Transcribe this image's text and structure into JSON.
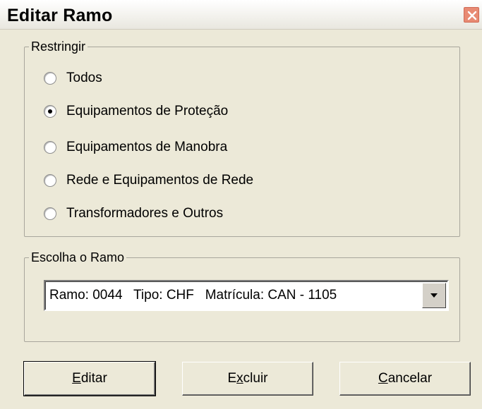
{
  "window": {
    "title": "Editar Ramo"
  },
  "restrict": {
    "legend": "Restringir",
    "options": [
      {
        "label": "Todos",
        "checked": false
      },
      {
        "label": "Equipamentos de Proteção",
        "checked": true
      },
      {
        "label": "Equipamentos de Manobra",
        "checked": false
      },
      {
        "label": "Rede e Equipamentos de Rede",
        "checked": false
      },
      {
        "label": "Transformadores e Outros",
        "checked": false
      }
    ]
  },
  "branch": {
    "legend": "Escolha o Ramo",
    "selected": "Ramo: 0044   Tipo: CHF   Matrícula: CAN - 1105"
  },
  "buttons": {
    "edit": {
      "pre": "",
      "accel": "E",
      "post": "ditar"
    },
    "delete": {
      "pre": "E",
      "accel": "x",
      "post": "cluir"
    },
    "cancel": {
      "pre": "",
      "accel": "C",
      "post": "ancelar"
    }
  }
}
